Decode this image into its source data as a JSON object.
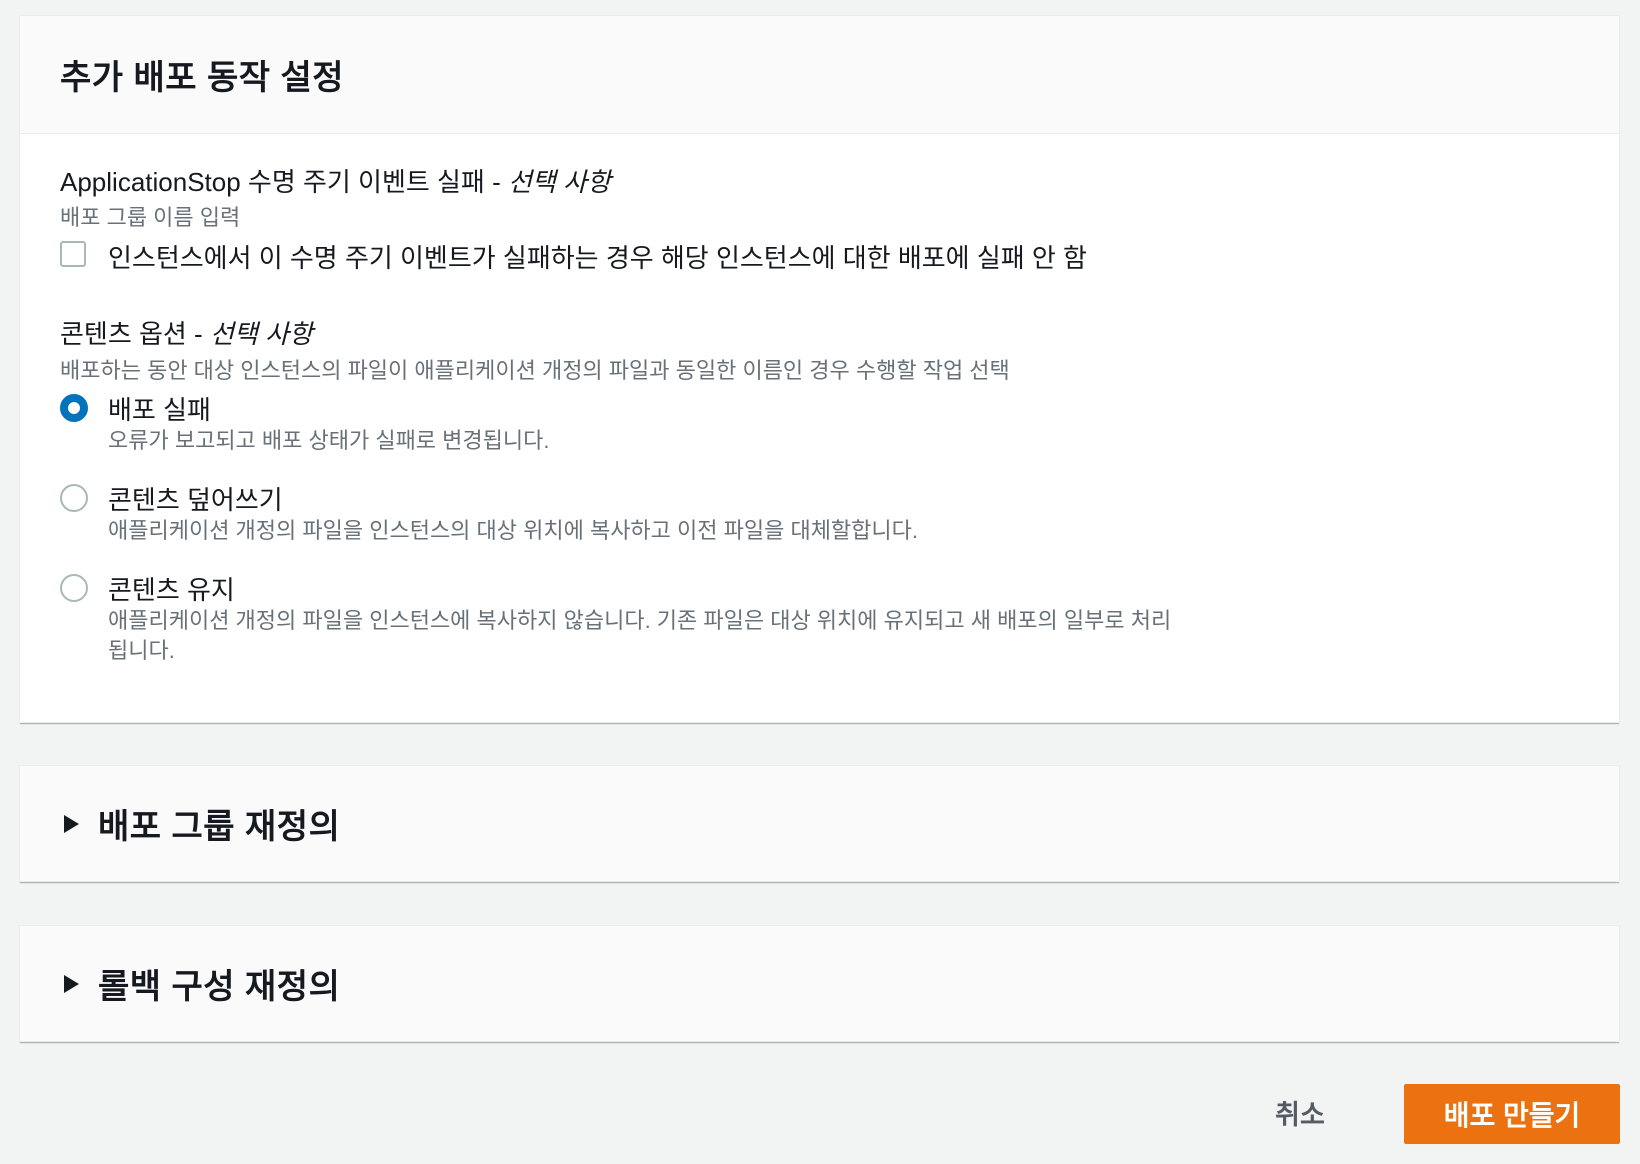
{
  "main_panel": {
    "title": "추가 배포 동작 설정",
    "app_stop": {
      "label": "ApplicationStop 수명 주기 이벤트 실패 - ",
      "optional": "선택 사항",
      "description": "배포 그룹 이름 입력",
      "checkbox_label": "인스턴스에서 이 수명 주기 이벤트가 실패하는 경우 해당 인스턴스에 대한 배포에 실패 안 함",
      "checked": false
    },
    "content_options": {
      "label": "콘텐츠 옵션 - ",
      "optional": "선택 사항",
      "description": "배포하는 동안 대상 인스턴스의 파일이 애플리케이션 개정의 파일과 동일한 이름인 경우 수행할 작업 선택",
      "selected": "배포 실패",
      "options": [
        {
          "label": "배포 실패",
          "description": "오류가 보고되고 배포 상태가 실패로 변경됩니다."
        },
        {
          "label": "콘텐츠 덮어쓰기",
          "description": "애플리케이션 개정의 파일을 인스턴스의 대상 위치에 복사하고 이전 파일을 대체할합니다."
        },
        {
          "label": "콘텐츠 유지",
          "description": "애플리케이션 개정의 파일을 인스턴스에 복사하지 않습니다. 기존 파일은 대상 위치에 유지되고 새 배포의 일부로 처리됩니다."
        }
      ]
    }
  },
  "deployment_group_override": {
    "title": "배포 그룹 재정의",
    "expanded": false
  },
  "rollback_override": {
    "title": "롤백 구성 재정의",
    "expanded": false
  },
  "footer": {
    "cancel_label": "취소",
    "create_label": "배포 만들기"
  },
  "colors": {
    "primary_button": "#ec7211",
    "radio_selected": "#0073bb",
    "background": "#f2f3f3"
  }
}
